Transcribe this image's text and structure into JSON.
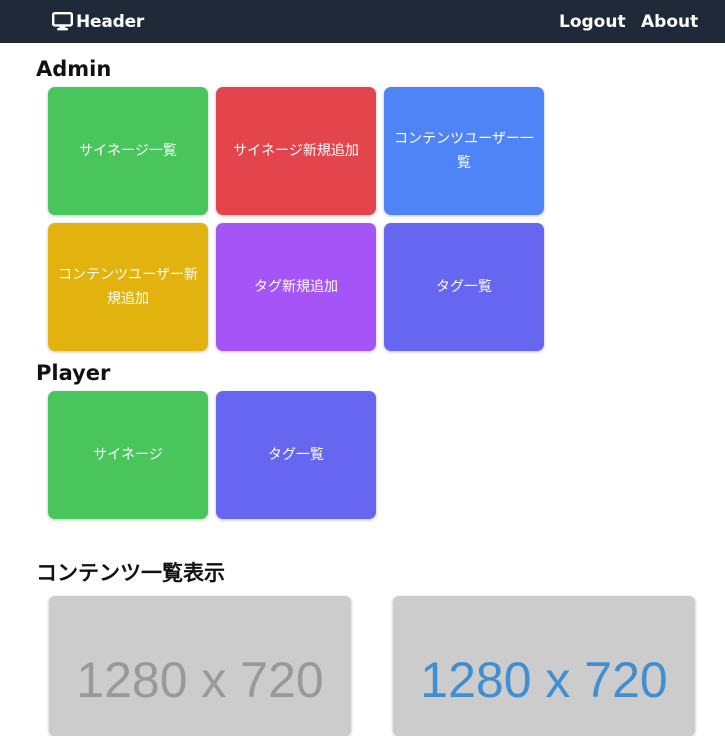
{
  "header": {
    "brand": "Header",
    "brand_icon": "monitor-icon",
    "nav": {
      "logout": "Logout",
      "about": "About"
    },
    "background": "#1f2937"
  },
  "admin": {
    "title": "Admin",
    "tiles": [
      {
        "label": "サイネージ一覧",
        "color": "#4ac55c"
      },
      {
        "label": "サイネージ新規追加",
        "color": "#e4454d"
      },
      {
        "label": "コンテンツユーザー一覧",
        "color": "#4f84f7"
      },
      {
        "label": "コンテンツユーザー新規追加",
        "color": "#e2b20f"
      },
      {
        "label": "タグ新規追加",
        "color": "#a555f7"
      },
      {
        "label": "タグ一覧",
        "color": "#6766f1"
      }
    ]
  },
  "player": {
    "title": "Player",
    "tiles": [
      {
        "label": "サイネージ",
        "color": "#4ac55c"
      },
      {
        "label": "タグ一覧",
        "color": "#6766f1"
      }
    ]
  },
  "contents": {
    "title": "コンテンツ一覧表示",
    "thumbnails": [
      {
        "label": "1280 x 720",
        "text_color": "#999999"
      },
      {
        "label": "1280 x 720",
        "text_color": "#3f8fd2"
      }
    ]
  }
}
